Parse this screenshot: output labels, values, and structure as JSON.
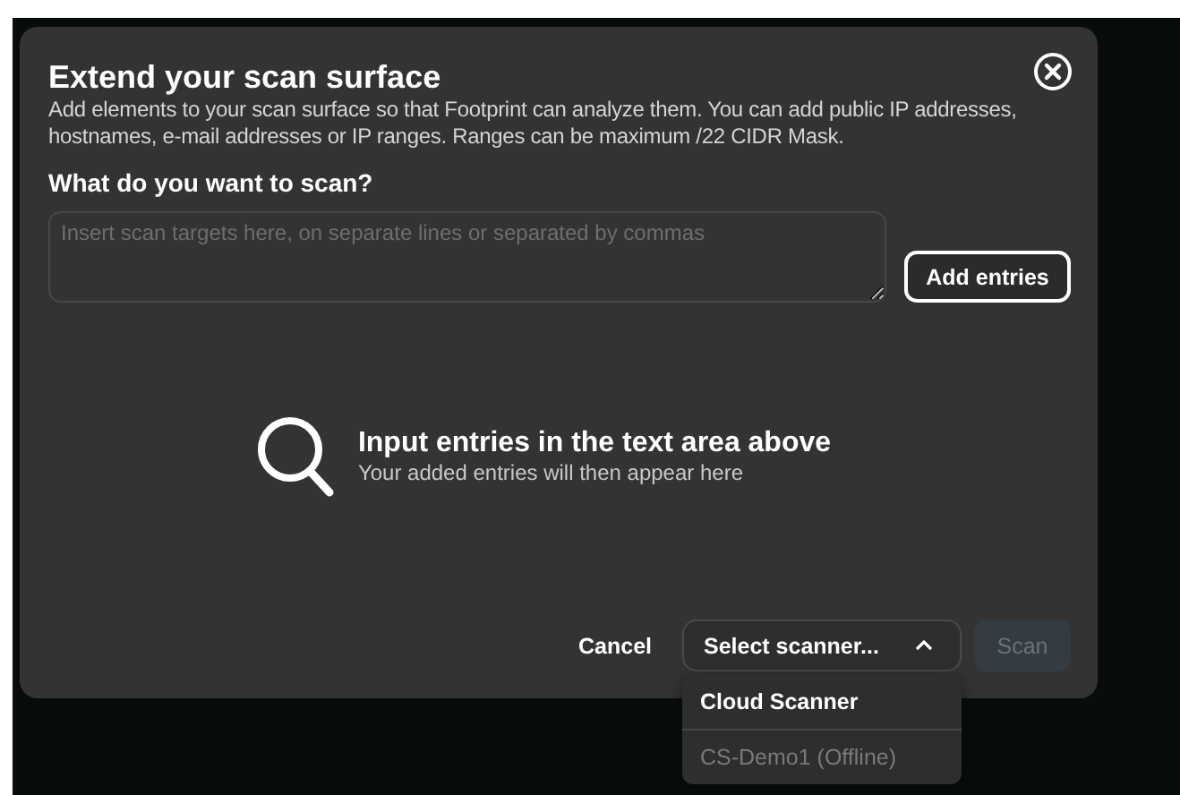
{
  "dialog": {
    "title": "Extend your scan surface",
    "description": "Add elements to your scan surface so that Footprint can analyze them. You can add public IP addresses, hostnames, e-mail addresses or IP ranges. Ranges can be maximum /22 CIDR Mask.",
    "prompt": "What do you want to scan?",
    "targets": {
      "placeholder": "Insert scan targets here, on separate lines or separated by commas"
    },
    "add_button": "Add entries",
    "empty_state": {
      "title": "Input entries in the text area above",
      "subtitle": "Your added entries will then appear here"
    },
    "cancel_button": "Cancel",
    "scanner_select": {
      "value": "Select scanner...",
      "expanded": true,
      "options": [
        {
          "label": "Cloud Scanner",
          "disabled": false
        },
        {
          "label": "CS-Demo1 (Offline)",
          "disabled": true
        }
      ]
    },
    "scan_button": {
      "label": "Scan",
      "disabled": true
    }
  }
}
